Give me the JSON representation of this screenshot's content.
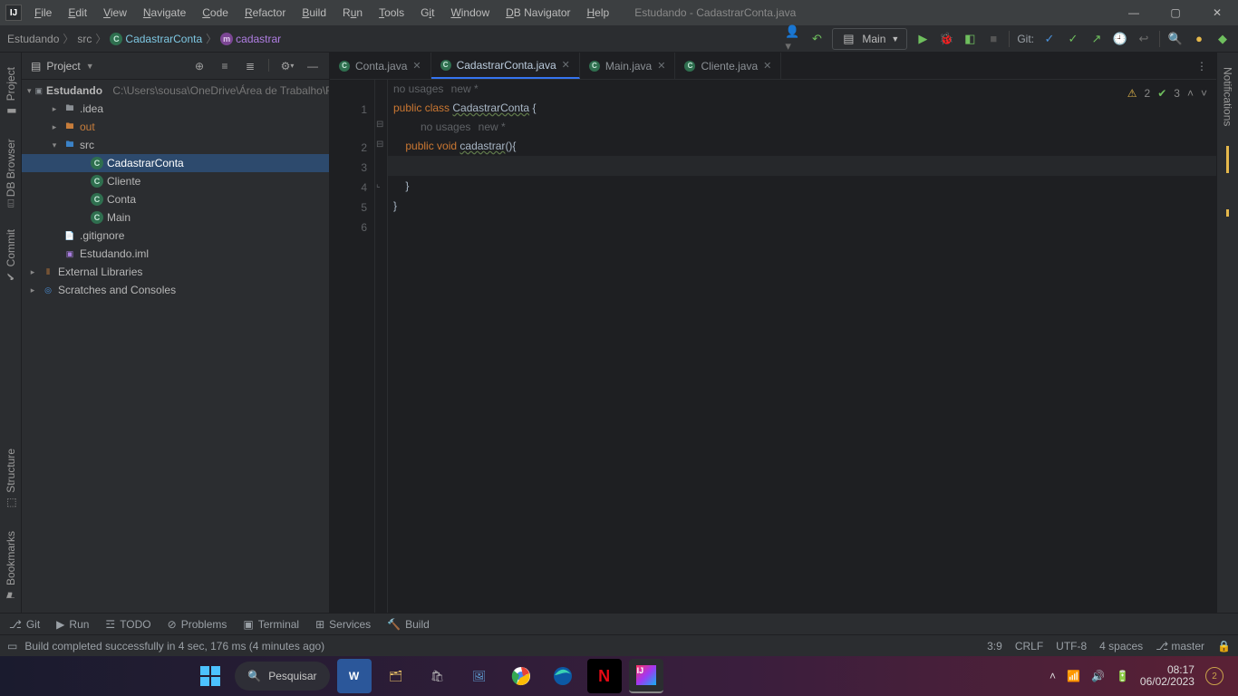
{
  "window_title": "Estudando - CadastrarConta.java",
  "menu": [
    "File",
    "Edit",
    "View",
    "Navigate",
    "Code",
    "Refactor",
    "Build",
    "Run",
    "Tools",
    "Git",
    "Window",
    "DB Navigator",
    "Help"
  ],
  "breadcrumbs": {
    "project": "Estudando",
    "module": "src",
    "class": "CadastrarConta",
    "method": "cadastrar"
  },
  "run_config": {
    "label": "Main"
  },
  "git_label": "Git:",
  "project_tw": {
    "title": "Project",
    "tree": {
      "root_name": "Estudando",
      "root_path": "C:\\Users\\sousa\\OneDrive\\Área de Trabalho\\F",
      "idea": ".idea",
      "out": "out",
      "src": "src",
      "classes": [
        "CadastrarConta",
        "Cliente",
        "Conta",
        "Main"
      ],
      "gitignore": ".gitignore",
      "iml": "Estudando.iml",
      "external": "External Libraries",
      "scratches": "Scratches and Consoles"
    }
  },
  "tabs": [
    {
      "label": "Conta.java",
      "active": false
    },
    {
      "label": "CadastrarConta.java",
      "active": true
    },
    {
      "label": "Main.java",
      "active": false
    },
    {
      "label": "Cliente.java",
      "active": false
    }
  ],
  "hints": {
    "no_usages": "no usages",
    "new": "new *"
  },
  "code": {
    "l1_kw1": "public",
    "l1_kw2": "class",
    "l1_name": "CadastrarConta",
    "l1_brace": " {",
    "l2_kw1": "public",
    "l2_kw2": "void",
    "l2_name": "cadastrar",
    "l2_rest": "(){",
    "l4": "    }",
    "l5": "}"
  },
  "gutter": [
    "1",
    "2",
    "3",
    "4",
    "5",
    "6"
  ],
  "inspections": {
    "warn_count": "2",
    "ok_count": "3"
  },
  "bottom_tools": [
    "Git",
    "Run",
    "TODO",
    "Problems",
    "Terminal",
    "Services",
    "Build"
  ],
  "status_msg": "Build completed successfully in 4 sec, 176 ms (4 minutes ago)",
  "status_right": {
    "pos": "3:9",
    "eol": "CRLF",
    "enc": "UTF-8",
    "indent": "4 spaces",
    "branch": "master"
  },
  "left_stripe": [
    "Project",
    "DB Browser",
    "Commit",
    "Structure",
    "Bookmarks"
  ],
  "right_stripe": [
    "Notifications"
  ],
  "taskbar": {
    "search_placeholder": "Pesquisar",
    "time": "08:17",
    "date": "06/02/2023",
    "notif_count": "2"
  }
}
